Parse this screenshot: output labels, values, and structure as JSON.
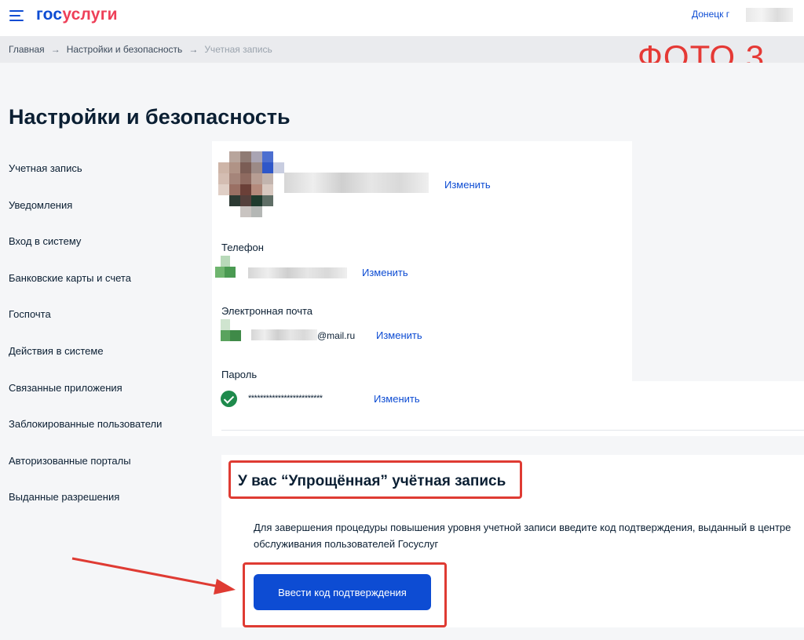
{
  "header": {
    "logo_part1": "гос",
    "logo_part2": "услуги",
    "city": "Донецк г"
  },
  "breadcrumbs": {
    "home": "Главная",
    "settings": "Настройки и безопасность",
    "current": "Учетная запись",
    "separator": "→"
  },
  "annotation": {
    "photo_label": "ФОТО 3"
  },
  "page_title": "Настройки и безопасность",
  "sidebar": {
    "items": [
      {
        "label": "Учетная запись"
      },
      {
        "label": "Уведомления"
      },
      {
        "label": "Вход в систему"
      },
      {
        "label": "Банковские карты и счета"
      },
      {
        "label": "Госпочта"
      },
      {
        "label": "Действия в системе"
      },
      {
        "label": "Связанные приложения"
      },
      {
        "label": "Заблокированные пользователи"
      },
      {
        "label": "Авторизованные порталы"
      },
      {
        "label": "Выданные разрешения"
      }
    ]
  },
  "account": {
    "change_label": "Изменить",
    "phone": {
      "label": "Телефон",
      "change_label": "Изменить"
    },
    "email": {
      "label": "Электронная почта",
      "value_suffix": "@mail.ru",
      "change_label": "Изменить"
    },
    "password": {
      "label": "Пароль",
      "value": "*************************",
      "change_label": "Изменить"
    }
  },
  "notice": {
    "title": "У вас “Упрощённая” учётная запись",
    "text": "Для завершения процедуры повышения уровня учетной записи введите код подтверждения, выданный в центре обслуживания пользователей Госуслуг",
    "button_label": "Ввести код подтверждения"
  },
  "colors": {
    "brand_blue": "#0d4cd3",
    "brand_red": "#ee3f58",
    "annotation_red": "#df3b33",
    "success_green": "#1e8a4c"
  }
}
